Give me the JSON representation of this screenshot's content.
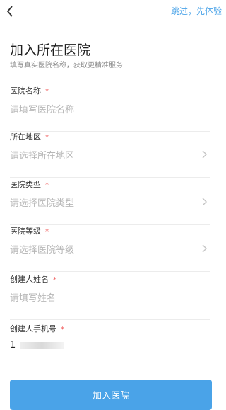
{
  "header": {
    "back_icon": "chevron-left-icon",
    "skip_label": "跳过，先体验"
  },
  "intro": {
    "title": "加入所在医院",
    "subtitle": "填写真实医院名称，获取更精准服务"
  },
  "fields": [
    {
      "label": "医院名称",
      "required_mark": "*",
      "placeholder": "请填写医院名称",
      "has_chevron": false
    },
    {
      "label": "所在地区",
      "required_mark": "*",
      "placeholder": "请选择所在地区",
      "has_chevron": true
    },
    {
      "label": "医院类型",
      "required_mark": "*",
      "placeholder": "请选择医院类型",
      "has_chevron": true
    },
    {
      "label": "医院等级",
      "required_mark": "*",
      "placeholder": "请选择医院等级",
      "has_chevron": true
    },
    {
      "label": "创建人姓名",
      "required_mark": "*",
      "placeholder": "请填写姓名",
      "has_chevron": false
    },
    {
      "label": "创建人手机号",
      "required_mark": "*",
      "value": "1",
      "has_chevron": false
    }
  ],
  "submit": {
    "label": "加入医院"
  },
  "colors": {
    "accent": "#4aa3e8",
    "required": "#f05a5a",
    "placeholder": "#b8b8b8"
  }
}
